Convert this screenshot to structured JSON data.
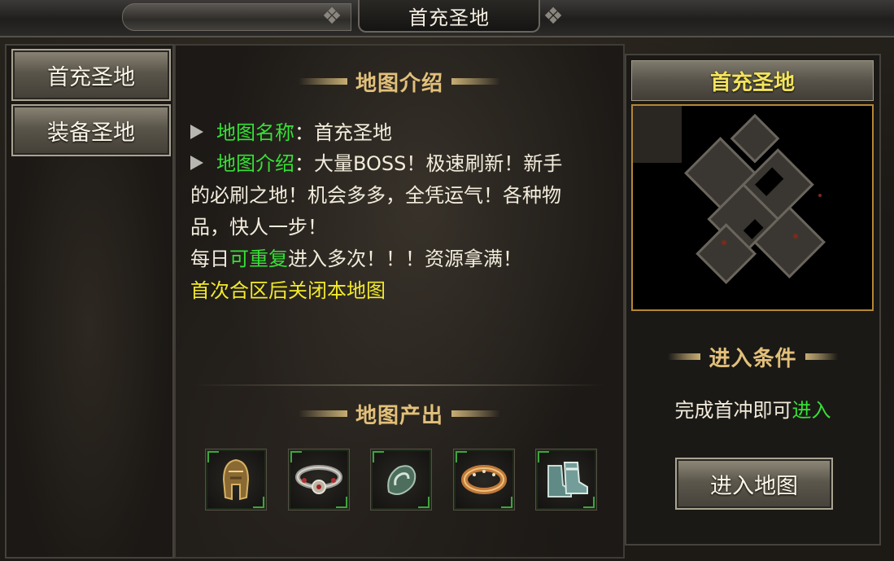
{
  "window": {
    "title": "首充圣地"
  },
  "sidebar": {
    "tabs": [
      {
        "label": "首充圣地"
      },
      {
        "label": "装备圣地"
      }
    ]
  },
  "center": {
    "intro_heading": "地图介绍",
    "map_name_label": "地图名称",
    "colon": "：",
    "map_name_value": "首充圣地",
    "map_intro_label": "地图介绍",
    "map_intro_line1": "大量BOSS！极速刷新！新手",
    "map_intro_line2": "的必刷之地！机会多多，全凭运气！各种物",
    "map_intro_line3": "品，快人一步！",
    "daily_prefix": "每日",
    "daily_highlight": "可重复",
    "daily_suffix": "进入多次！！！资源拿满！",
    "warning": "首次合区后关闭本地图",
    "output_heading": "地图产出",
    "items": [
      {
        "icon": "helmet-icon"
      },
      {
        "icon": "necklace-icon"
      },
      {
        "icon": "bracelet-icon"
      },
      {
        "icon": "ring-icon"
      },
      {
        "icon": "boots-icon"
      }
    ]
  },
  "right": {
    "map_title": "首充圣地",
    "condition_heading": "进入条件",
    "condition_prefix": "完成首冲即可",
    "condition_highlight": "进入",
    "enter_button": "进入地图"
  },
  "colors": {
    "accent_gold": "#e2c07a",
    "highlight_green": "#36e036",
    "warning_yellow": "#f2ea2a",
    "map_title_yellow": "#f3e35a"
  }
}
